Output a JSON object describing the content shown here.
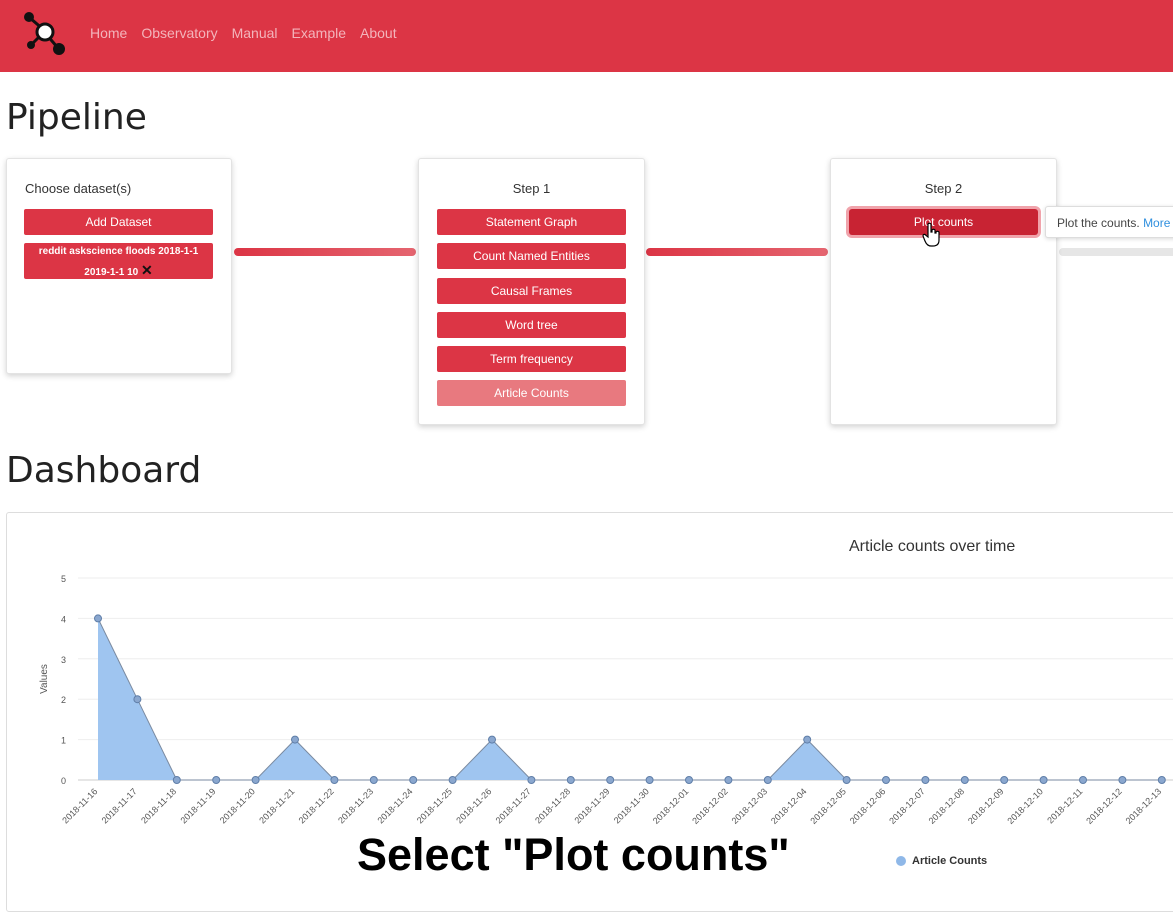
{
  "nav": {
    "links": [
      "Home",
      "Observatory",
      "Manual",
      "Example",
      "About"
    ]
  },
  "pipeline": {
    "heading": "Pipeline",
    "dataset_card": {
      "title": "Choose dataset(s)",
      "add_button": "Add Dataset",
      "dataset_line1": "reddit askscience floods 2018-1-1",
      "dataset_line2": "2019-1-1 10",
      "remove_icon": "✕"
    },
    "step1": {
      "title": "Step 1",
      "buttons": [
        "Statement Graph",
        "Count Named Entities",
        "Causal Frames",
        "Word tree",
        "Term frequency",
        "Article Counts"
      ]
    },
    "step2": {
      "title": "Step 2",
      "button": "Plot counts",
      "tooltip": "Plot the counts.",
      "tooltip_more": "More"
    }
  },
  "dashboard": {
    "heading": "Dashboard",
    "caption": "Select \"Plot counts\""
  },
  "colors": {
    "brand": "#dc3545",
    "area_fill": "#9fc5f0",
    "point": "#8aa7cf"
  },
  "chart_data": {
    "type": "area",
    "title": "Article counts over time",
    "ylabel": "Values",
    "xlabel": "",
    "ylim": [
      0,
      5
    ],
    "yticks": [
      0,
      1,
      2,
      3,
      4,
      5
    ],
    "grid": true,
    "legend_position": "bottom",
    "categories": [
      "2018-11-16",
      "2018-11-17",
      "2018-11-18",
      "2018-11-19",
      "2018-11-20",
      "2018-11-21",
      "2018-11-22",
      "2018-11-23",
      "2018-11-24",
      "2018-11-25",
      "2018-11-26",
      "2018-11-27",
      "2018-11-28",
      "2018-11-29",
      "2018-11-30",
      "2018-12-01",
      "2018-12-02",
      "2018-12-03",
      "2018-12-04",
      "2018-12-05",
      "2018-12-06",
      "2018-12-07",
      "2018-12-08",
      "2018-12-09",
      "2018-12-10",
      "2018-12-11",
      "2018-12-12",
      "2018-12-13"
    ],
    "series": [
      {
        "name": "Article Counts",
        "values": [
          4,
          2,
          0,
          0,
          0,
          1,
          0,
          0,
          0,
          0,
          1,
          0,
          0,
          0,
          0,
          0,
          0,
          0,
          1,
          0,
          0,
          0,
          0,
          0,
          0,
          0,
          0,
          0
        ]
      }
    ]
  }
}
